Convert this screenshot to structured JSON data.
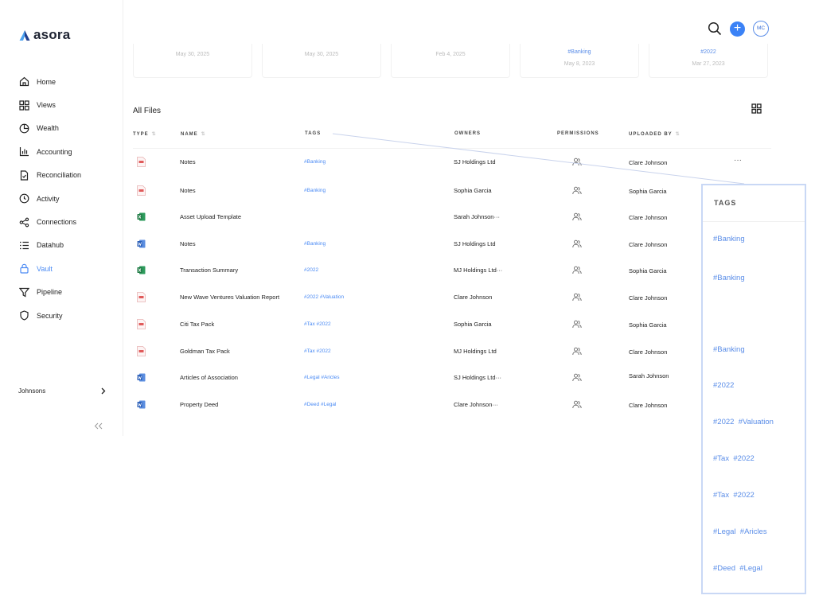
{
  "app": {
    "name": "asora"
  },
  "nav": [
    {
      "label": "Home",
      "icon": "home-icon"
    },
    {
      "label": "Views",
      "icon": "views-icon"
    },
    {
      "label": "Wealth",
      "icon": "pie-chart-icon"
    },
    {
      "label": "Accounting",
      "icon": "bar-chart-icon"
    },
    {
      "label": "Reconciliation",
      "icon": "document-check-icon"
    },
    {
      "label": "Activity",
      "icon": "clock-icon"
    },
    {
      "label": "Connections",
      "icon": "share-icon"
    },
    {
      "label": "Datahub",
      "icon": "list-icon"
    },
    {
      "label": "Vault",
      "icon": "lock-icon",
      "active": true
    },
    {
      "label": "Pipeline",
      "icon": "filter-icon"
    },
    {
      "label": "Security",
      "icon": "shield-icon"
    }
  ],
  "workspace": {
    "name": "Johnsons"
  },
  "user": {
    "initials": "MC"
  },
  "colors": {
    "accent": "#3b82f6",
    "tag": "#4a8af4",
    "pdf": "#e05a5a",
    "excel": "#1f7a44",
    "word": "#2b5fb8"
  },
  "recent_cards": [
    {
      "tag": "",
      "date": "May 30, 2025"
    },
    {
      "tag": "",
      "date": "May 30, 2025"
    },
    {
      "tag": "",
      "date": "Feb 4, 2025"
    },
    {
      "tag": "#Banking",
      "date": "May 8, 2023"
    },
    {
      "tag": "#2022",
      "date": "Mar 27, 2023"
    }
  ],
  "files": {
    "title": "All Files",
    "columns": {
      "type": "TYPE",
      "name": "NAME",
      "tags": "TAGS",
      "owners": "OWNERS",
      "permissions": "PERMISSIONS",
      "uploaded_by": "UPLOADED BY"
    },
    "rows": [
      {
        "type": "pdf",
        "name": "Notes",
        "tags": "#Banking",
        "owner": "SJ Holdings Ltd",
        "uploader": "Clare Johnson"
      },
      {
        "type": "pdf",
        "name": "Notes",
        "tags": "#Banking",
        "owner": "Sophia Garcia",
        "uploader": "Sophia Garcia"
      },
      {
        "type": "excel",
        "name": "Asset Upload Template",
        "tags": "",
        "owner": "Sarah Johnson···",
        "uploader": "Clare Johnson"
      },
      {
        "type": "word",
        "name": "Notes",
        "tags": "#Banking",
        "owner": "SJ Holdings Ltd",
        "uploader": "Clare Johnson"
      },
      {
        "type": "excel",
        "name": "Transaction Summary",
        "tags": "#2022",
        "owner": "MJ Holdings Ltd···",
        "uploader": "Sophia Garcia"
      },
      {
        "type": "pdf",
        "name": "New Wave Ventures Valuation Report",
        "tags": "#2022 #Valuation",
        "owner": "Clare Johnson",
        "uploader": "Clare Johnson"
      },
      {
        "type": "pdf",
        "name": "Citi Tax Pack",
        "tags": "#Tax #2022",
        "owner": "Sophia Garcia",
        "uploader": "Sophia Garcia"
      },
      {
        "type": "pdf",
        "name": "Goldman Tax Pack",
        "tags": "#Tax #2022",
        "owner": "MJ Holdings Ltd",
        "uploader": "Clare Johnson"
      },
      {
        "type": "word",
        "name": "Articles of Association",
        "tags": "#Legal #Aricles",
        "owner": "SJ Holdings Ltd···",
        "uploader": "Sarah Johnson"
      },
      {
        "type": "word",
        "name": "Property Deed",
        "tags": "#Deed #Legal",
        "owner": "Clare Johnson···",
        "uploader": "Clare Johnson"
      }
    ],
    "more_label": "···"
  },
  "zoom": {
    "title": "TAGS",
    "tags": [
      "#Banking",
      "#Banking",
      "#Banking",
      "#2022",
      "#2022  #Valuation",
      "#Tax  #2022",
      "#Tax  #2022",
      "#Legal  #Aricles",
      "#Deed  #Legal"
    ]
  }
}
